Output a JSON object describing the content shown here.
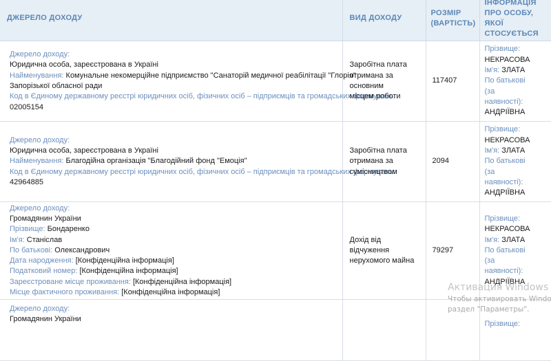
{
  "headers": {
    "source": "ДЖЕРЕЛО ДОХОДУ",
    "type": "ВИД ДОХОДУ",
    "amount_line1": "РОЗМІР",
    "amount_line2": "(ВАРТІСТЬ)",
    "person_line1": "ІНФОРМАЦІЯ",
    "person_line2": "ПРО ОСОБУ,",
    "person_line3": "ЯКОЇ",
    "person_line4": "СТОСУЄТЬСЯ"
  },
  "rows": [
    {
      "source_label": "Джерело доходу:",
      "source_kind": "Юридична особа, зареєстрована в Україні",
      "name_label": "Найменування:",
      "name_value": "Комунальне некомерційне підприємство \"Санаторій медичної реабілітації \"Глорія\"",
      "name_value_cont": "Запорізької обласної ради",
      "code_label": "Код в Єдиному державному реєстрі юридичних осіб, фізичних осіб – підприємців та громадських формувань:",
      "code_value": "02005154",
      "type_line1": "Заробітна плата",
      "type_line2": "отримана за основним",
      "type_line3": "місцем роботи",
      "amount": "117407",
      "person": {
        "surname_label": "Прізвище:",
        "surname": "НЕКРАСОВА",
        "name_label": "Ім'я:",
        "name": "ЗЛАТА",
        "patronymic_label1": "По батькові",
        "patronymic_label2": "(за",
        "patronymic_label3": "наявності):",
        "patronymic": "АНДРІЇВНА"
      }
    },
    {
      "source_label": "Джерело доходу:",
      "source_kind": "Юридична особа, зареєстрована в Україні",
      "name_label": "Найменування:",
      "name_value": "Благодійна організація \"Благодійний фонд \"Емоція\"",
      "code_label": "Код в Єдиному державному реєстрі юридичних осіб, фізичних осіб – підприємців та громадських формувань:",
      "code_value": "42964885",
      "type_line1": "Заробітна плата",
      "type_line2": "отримана за",
      "type_line3": "сумісництвом",
      "amount": "2094",
      "person": {
        "surname_label": "Прізвище:",
        "surname": "НЕКРАСОВА",
        "name_label": "Ім'я:",
        "name": "ЗЛАТА",
        "patronymic_label1": "По батькові",
        "patronymic_label2": "(за",
        "patronymic_label3": "наявності):",
        "patronymic": "АНДРІЇВНА"
      }
    },
    {
      "source_label": "Джерело доходу:",
      "source_kind": "Громадянин України",
      "surname_label": "Прізвище:",
      "surname_value": "Бондаренко",
      "firstname_label": "Ім'я:",
      "firstname_value": "Станіслав",
      "patronymic_label": "По батькові:",
      "patronymic_value": "Олександрович",
      "dob_label": "Дата народження:",
      "dob_value": "[Конфіденційна інформація]",
      "tax_label": "Податковий номер:",
      "tax_value": "[Конфіденційна інформація]",
      "reg_label": "Зареєстроване місце проживання:",
      "reg_value": "[Конфіденційна інформація]",
      "actual_label": "Місце фактичного проживання:",
      "actual_value": "[Конфіденційна інформація]",
      "type_line1": "Дохід від відчуження",
      "type_line2": "нерухомого майна",
      "amount": "79297",
      "person": {
        "surname_label": "Прізвище:",
        "surname": "НЕКРАСОВА",
        "name_label": "Ім'я:",
        "name": "ЗЛАТА",
        "patronymic_label1": "По батькові",
        "patronymic_label2": "(за",
        "patronymic_label3": "наявності):",
        "patronymic": "АНДРІЇВНА"
      }
    },
    {
      "source_label": "Джерело доходу:",
      "source_kind": "Громадянин України",
      "person": {
        "surname_label": "Прізвище:"
      }
    }
  ],
  "watermark": {
    "title": "Активация Windows",
    "line1": "Чтобы активировать Windo",
    "line2": "раздел \"Параметры\"."
  }
}
